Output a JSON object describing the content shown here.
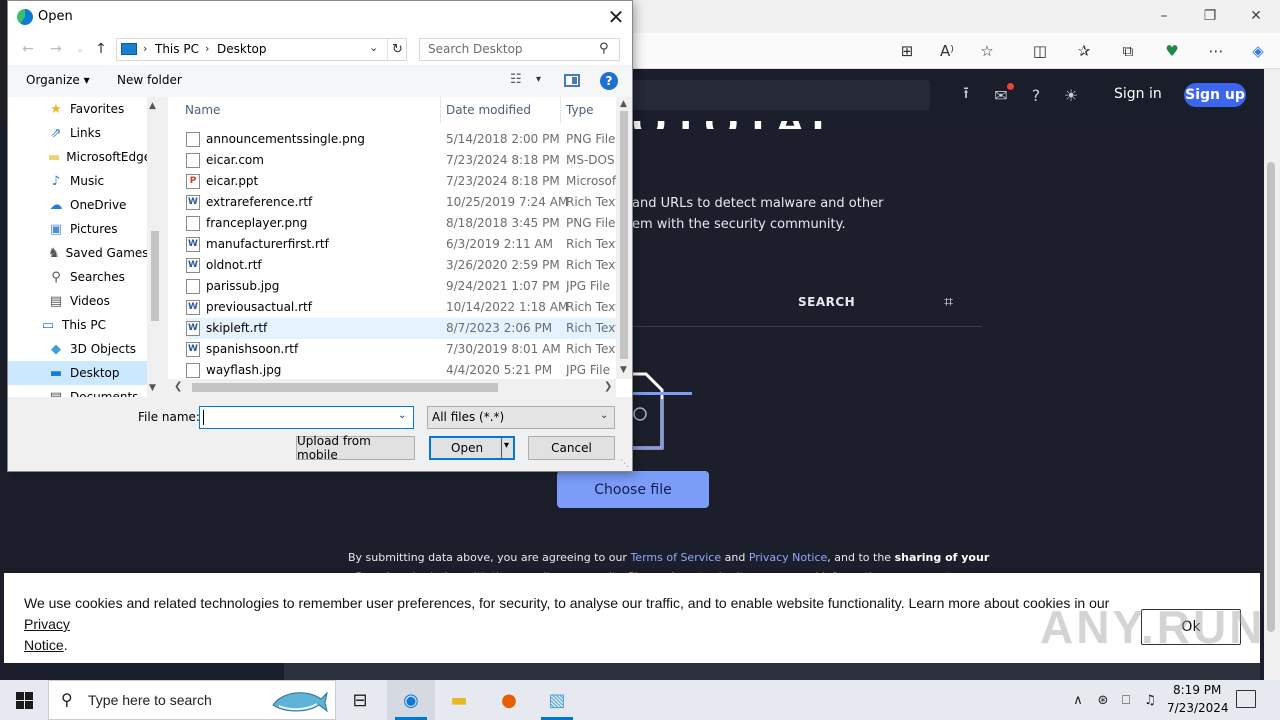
{
  "dialog": {
    "title": "Open",
    "close_glyph": "✕",
    "nav": {
      "back_glyph": "←",
      "forward_glyph": "→",
      "recent_glyph": "⌄",
      "up_glyph": "↑",
      "breadcrumb": [
        "This PC",
        "Desktop"
      ],
      "breadcrumb_sep": "›",
      "dropdown_glyph": "⌄",
      "refresh_glyph": "↻"
    },
    "search": {
      "placeholder": "Search Desktop",
      "icon": "search-icon"
    },
    "commands": {
      "organize": "Organize ▾",
      "new_folder": "New folder",
      "view_glyph": "☷",
      "view_dd_glyph": "▾",
      "help_glyph": "?"
    },
    "nav_pane": {
      "items": [
        {
          "label": "Favorites",
          "icon": "star-icon",
          "glyph": "★",
          "color": "#e8b923",
          "indent": 1
        },
        {
          "label": "Links",
          "icon": "links-icon",
          "glyph": "⇗",
          "color": "#2b7bd6",
          "indent": 1
        },
        {
          "label": "MicrosoftEdge",
          "icon": "folder-icon",
          "glyph": "▬",
          "color": "#f1d072",
          "indent": 1
        },
        {
          "label": "Music",
          "icon": "music-icon",
          "glyph": "♪",
          "color": "#2b7bd6",
          "indent": 1
        },
        {
          "label": "OneDrive",
          "icon": "cloud-icon",
          "glyph": "☁",
          "color": "#2b7bd6",
          "indent": 1
        },
        {
          "label": "Pictures",
          "icon": "pictures-icon",
          "glyph": "▣",
          "color": "#4a8fd1",
          "indent": 1
        },
        {
          "label": "Saved Games",
          "icon": "saved-games-icon",
          "glyph": "♞",
          "color": "#555555",
          "indent": 1
        },
        {
          "label": "Searches",
          "icon": "searches-icon",
          "glyph": "⚲",
          "color": "#555555",
          "indent": 1
        },
        {
          "label": "Videos",
          "icon": "videos-icon",
          "glyph": "▤",
          "color": "#555555",
          "indent": 1
        },
        {
          "label": "This PC",
          "icon": "computer-icon",
          "glyph": "▭",
          "color": "#1a7fd1",
          "indent": 0
        },
        {
          "label": "3D Objects",
          "icon": "cube-icon",
          "glyph": "◆",
          "color": "#3aa0d8",
          "indent": 1
        },
        {
          "label": "Desktop",
          "icon": "desktop-icon",
          "glyph": "▬",
          "color": "#1a7fd1",
          "indent": 1,
          "selected": true
        },
        {
          "label": "Documents",
          "icon": "documents-icon",
          "glyph": "▤",
          "color": "#555555",
          "indent": 1
        }
      ]
    },
    "columns": {
      "name": "Name",
      "date": "Date modified",
      "type": "Type",
      "sort_glyph": "˄"
    },
    "files": [
      {
        "name": "announcementssingle.png",
        "date": "5/14/2018 2:00 PM",
        "type": "PNG File",
        "icon": "image-file-icon"
      },
      {
        "name": "eicar.com",
        "date": "7/23/2024 8:18 PM",
        "type": "MS-DOS...",
        "icon": "executable-file-icon"
      },
      {
        "name": "eicar.ppt",
        "date": "7/23/2024 8:18 PM",
        "type": "Microsoft...",
        "icon": "powerpoint-file-icon"
      },
      {
        "name": "extrareference.rtf",
        "date": "10/25/2019 7:24 AM",
        "type": "Rich Text...",
        "icon": "word-file-icon"
      },
      {
        "name": "franceplayer.png",
        "date": "8/18/2018 3:45 PM",
        "type": "PNG File",
        "icon": "image-file-icon"
      },
      {
        "name": "manufacturerfirst.rtf",
        "date": "6/3/2019 2:11 AM",
        "type": "Rich Text...",
        "icon": "word-file-icon"
      },
      {
        "name": "oldnot.rtf",
        "date": "3/26/2020 2:59 PM",
        "type": "Rich Text...",
        "icon": "word-file-icon"
      },
      {
        "name": "parissub.jpg",
        "date": "9/24/2021 1:07 PM",
        "type": "JPG File",
        "icon": "image-file-icon"
      },
      {
        "name": "previousactual.rtf",
        "date": "10/14/2022 1:18 AM",
        "type": "Rich Text...",
        "icon": "word-file-icon"
      },
      {
        "name": "skipleft.rtf",
        "date": "8/7/2023 2:06 PM",
        "type": "Rich Text...",
        "icon": "word-file-icon",
        "highlighted": true
      },
      {
        "name": "spanishsoon.rtf",
        "date": "7/30/2019 8:01 AM",
        "type": "Rich Text...",
        "icon": "word-file-icon"
      },
      {
        "name": "wayflash.jpg",
        "date": "4/4/2020 5:21 PM",
        "type": "JPG File",
        "icon": "image-file-icon"
      }
    ],
    "file_name": {
      "label": "File name:",
      "value": ""
    },
    "filter": {
      "value": "All files (*.*)"
    },
    "buttons": {
      "upload": "Upload from mobile",
      "open": "Open",
      "cancel": "Cancel"
    }
  },
  "browser": {
    "window_controls": {
      "minimize": "–",
      "maximize": "❐",
      "close": "✕"
    },
    "toolbar_glyphs": {
      "apps": "⊞",
      "read_aloud": "A⁾",
      "favorite": "☆",
      "split": "◫",
      "favorites": "✰",
      "collections": "⧉",
      "heartbeat": "♥",
      "more": "⋯",
      "copilot": "◈"
    },
    "header_glyphs": {
      "upload": "⭱",
      "chat": "✉",
      "help": "?",
      "theme": "☀"
    },
    "sign_in": "Sign in",
    "sign_up": "Sign up",
    "logo_fragment": "OTOTAL",
    "intro_line1": "and URLs to detect malware and other",
    "intro_line2": "em with the security community.",
    "tab_search": "SEARCH",
    "tab_extra_glyph": "⌗",
    "choose_file": "Choose file",
    "terms": {
      "prefix": "By submitting data above, you are agreeing to our ",
      "tos": "Terms of Service",
      "and": " and ",
      "privacy": "Privacy Notice",
      "mid": ", and to the ",
      "bold": "sharing of your",
      "line2": "Sample submission with the security community. Please do not submit any personal information; we are not"
    },
    "cookie": {
      "text": "We use cookies and related technologies to remember user preferences, for security, to analyse our traffic, and to enable website functionality. Learn more about cookies in our ",
      "link1": "Privacy",
      "link2": "Notice",
      "end": ".",
      "ok": "Ok"
    },
    "watermark": "ANY.RUN"
  },
  "taskbar": {
    "search_placeholder": "Type here to search",
    "search_glyph": "⚲",
    "apps": [
      {
        "name": "task-view-icon",
        "glyph": "⊟",
        "color": "#222222"
      },
      {
        "name": "edge-icon",
        "glyph": "◉",
        "color": "#0b7bd6",
        "active": true,
        "open": true
      },
      {
        "name": "file-explorer-icon",
        "glyph": "▬",
        "color": "#e8b923"
      },
      {
        "name": "firefox-icon",
        "glyph": "●",
        "color": "#e66000"
      },
      {
        "name": "notepad-icon",
        "glyph": "▧",
        "color": "#4aa3d8",
        "active": true
      }
    ],
    "tray_glyphs": {
      "chevron": "∧",
      "network_alt": "⊛",
      "network": "⎕",
      "volume": "♫"
    },
    "time": "8:19 PM",
    "date": "7/23/2024"
  }
}
